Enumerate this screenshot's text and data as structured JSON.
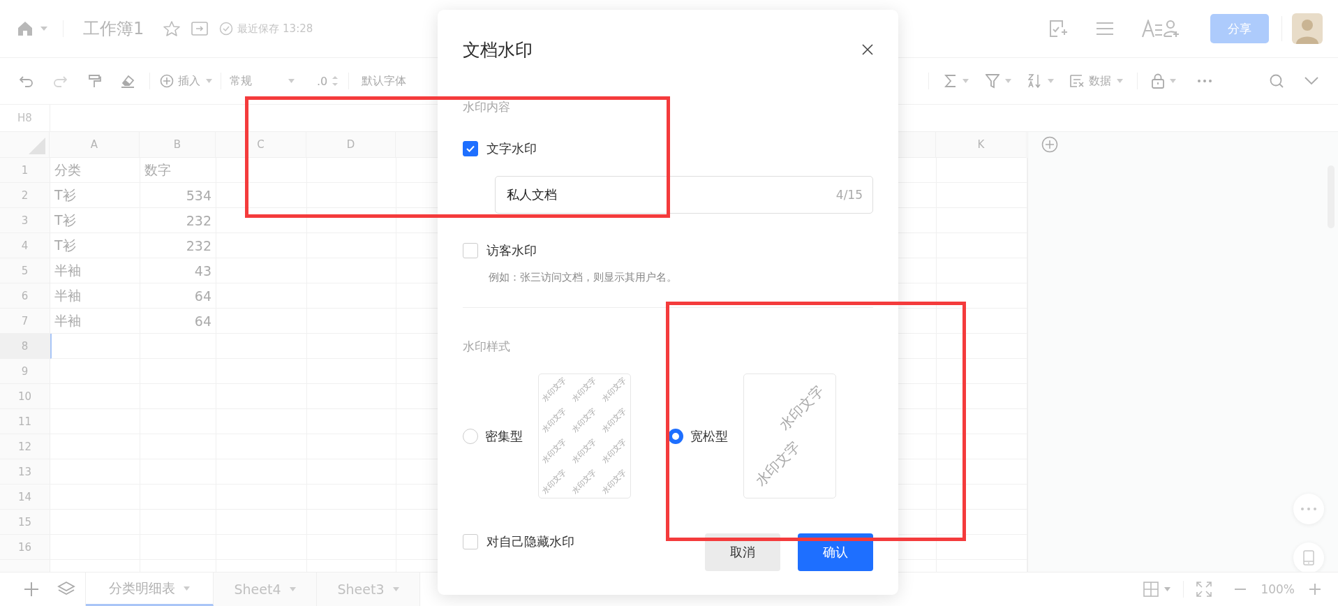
{
  "topbar": {
    "title": "工作簿1",
    "save_status": "最近保存 13:28",
    "share_button": "分享"
  },
  "toolbar": {
    "insert": "插入",
    "number_format": "常规",
    "decimal": ".0",
    "font": "默认字体",
    "data": "数据"
  },
  "formula_bar": {
    "cell_ref": "H8"
  },
  "sheet": {
    "columns": [
      {
        "label": "A"
      },
      {
        "label": "B"
      },
      {
        "label": "C"
      },
      {
        "label": "D"
      },
      {
        "label": "K"
      }
    ],
    "rows": [
      {
        "number": "1",
        "selected": false,
        "cells": [
          {
            "text": "分类",
            "kind": "text"
          },
          {
            "text": "数字",
            "kind": "text"
          }
        ]
      },
      {
        "number": "2",
        "selected": false,
        "cells": [
          {
            "text": "T衫",
            "kind": "text"
          },
          {
            "text": "534",
            "kind": "number"
          }
        ]
      },
      {
        "number": "3",
        "selected": false,
        "cells": [
          {
            "text": "T衫",
            "kind": "text"
          },
          {
            "text": "232",
            "kind": "number"
          }
        ]
      },
      {
        "number": "4",
        "selected": false,
        "cells": [
          {
            "text": "T衫",
            "kind": "text"
          },
          {
            "text": "232",
            "kind": "number"
          }
        ]
      },
      {
        "number": "5",
        "selected": false,
        "cells": [
          {
            "text": "半袖",
            "kind": "text"
          },
          {
            "text": "43",
            "kind": "number"
          }
        ]
      },
      {
        "number": "6",
        "selected": false,
        "cells": [
          {
            "text": "半袖",
            "kind": "text"
          },
          {
            "text": "64",
            "kind": "number"
          }
        ]
      },
      {
        "number": "7",
        "selected": false,
        "cells": [
          {
            "text": "半袖",
            "kind": "text"
          },
          {
            "text": "64",
            "kind": "number"
          }
        ]
      },
      {
        "number": "8",
        "selected": true,
        "cells": []
      },
      {
        "number": "9",
        "selected": false,
        "cells": []
      },
      {
        "number": "10",
        "selected": false,
        "cells": []
      },
      {
        "number": "11",
        "selected": false,
        "cells": []
      },
      {
        "number": "12",
        "selected": false,
        "cells": []
      },
      {
        "number": "13",
        "selected": false,
        "cells": []
      },
      {
        "number": "14",
        "selected": false,
        "cells": []
      },
      {
        "number": "15",
        "selected": false,
        "cells": []
      },
      {
        "number": "16",
        "selected": false,
        "cells": []
      }
    ]
  },
  "sheet_tabs": [
    {
      "label": "分类明细表",
      "selected": true
    },
    {
      "label": "Sheet4",
      "selected": false
    },
    {
      "label": "Sheet3",
      "selected": false
    }
  ],
  "zoom": "100%",
  "dialog": {
    "title": "文档水印",
    "content_section": "水印内容",
    "text_watermark": {
      "label": "文字水印",
      "checked": true,
      "value": "私人文档",
      "counter": "4/15"
    },
    "visitor_watermark": {
      "label": "访客水印",
      "checked": false,
      "hint": "例如：张三访问文档，则显示其用户名。"
    },
    "style_section": "水印样式",
    "styles": [
      {
        "label": "密集型",
        "selected": false,
        "kind": "dense",
        "preview_texts": [
          "水印文字",
          "水印文字",
          "水印文字",
          "水印文字",
          "水印文字",
          "水印文字",
          "水印文字",
          "水印文字",
          "水印文字",
          "水印文字",
          "水印文字",
          "水印文字"
        ]
      },
      {
        "label": "宽松型",
        "selected": true,
        "kind": "loose",
        "preview_texts": [
          "水印文字",
          "水印文字"
        ]
      }
    ],
    "hide_for_self": {
      "label": "对自己隐藏水印",
      "checked": false
    },
    "buttons": [
      {
        "label": "取消",
        "kind": "secondary"
      },
      {
        "label": "确认",
        "kind": "primary"
      }
    ]
  }
}
